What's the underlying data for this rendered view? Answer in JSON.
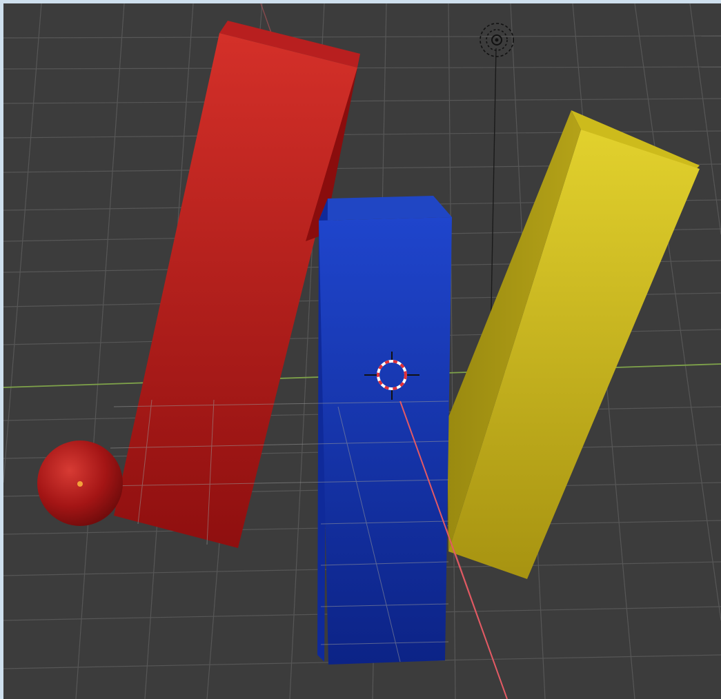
{
  "viewport": {
    "background_color": "#3c3c3c",
    "frame_color": "#cfe0ee",
    "grid_color": "#585858",
    "x_axis_color": "#d2585f",
    "y_axis_color": "#7fa34a"
  },
  "objects": [
    {
      "name": "red-box",
      "color": "#c21a1a",
      "shape": "box"
    },
    {
      "name": "blue-box",
      "color": "#1a3fc0",
      "shape": "box"
    },
    {
      "name": "yellow-box",
      "color": "#d1bf17",
      "shape": "box"
    },
    {
      "name": "red-sphere",
      "color": "#b01818",
      "shape": "sphere"
    }
  ],
  "gizmos": {
    "light_icon": "light-icon",
    "cursor_icon": "3d-cursor-icon",
    "origin_dot_color": "#f2a23a"
  }
}
